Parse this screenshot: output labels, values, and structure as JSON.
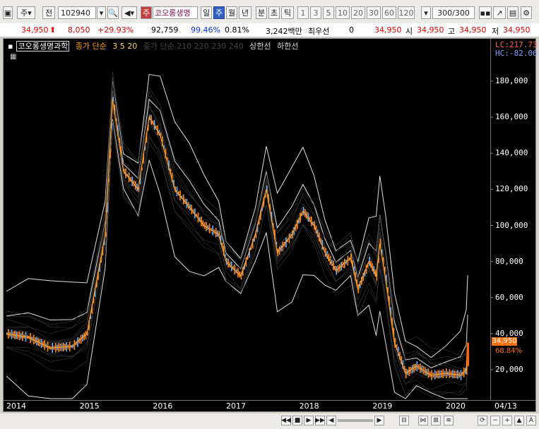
{
  "toolbar": {
    "market": "주",
    "market2": "전",
    "code": "102940",
    "name": "코오롱생명",
    "period_label": "주",
    "periods": [
      "일",
      "주",
      "월",
      "년",
      "분",
      "초",
      "틱"
    ],
    "intervals": [
      "1",
      "3",
      "5",
      "10",
      "20",
      "30",
      "60",
      "120"
    ],
    "count": "300/300"
  },
  "quote": {
    "price": "34,950",
    "change": "8,050",
    "change_pct": "+29.93%",
    "volume": "92,759",
    "vol_ratio": "99.46%",
    "turnover": "0.81%",
    "amount": "3,242백만",
    "pref_label": "최우선",
    "pref_val": "0",
    "last": "34,950",
    "open_label": "시",
    "open": "34,950",
    "high_label": "고",
    "high": "34,950",
    "low_label": "저",
    "low": "34,950"
  },
  "legend": {
    "name": "코오롱생명과학",
    "ma_label": "종가 단순",
    "ma_periods": "3  5  20",
    "ma2_label": "종가 단순 210 220 230 240",
    "upper": "상한선",
    "lower": "하한선"
  },
  "chart_data": {
    "type": "line",
    "y_ticks": [
      "180,000",
      "160,000",
      "140,000",
      "120,000",
      "100,000",
      "80,000",
      "60,000",
      "40,000",
      "20,000"
    ],
    "x_ticks": [
      "2014",
      "2015",
      "2016",
      "2017",
      "2018",
      "2019",
      "2020",
      "04/13"
    ],
    "lc": "LC:217.73",
    "hc": "HC:-82.06",
    "last_price": "34,950",
    "last_pct": "68.84%",
    "ylim": [
      0,
      200000
    ],
    "series": [
      {
        "values": [
          [
            2014.0,
            40000
          ],
          [
            2014.3,
            38000
          ],
          [
            2014.6,
            32000
          ],
          [
            2014.9,
            33000
          ],
          [
            2015.1,
            40000
          ],
          [
            2015.35,
            95000
          ],
          [
            2015.45,
            170000
          ],
          [
            2015.6,
            130000
          ],
          [
            2015.8,
            120000
          ],
          [
            2015.95,
            160000
          ],
          [
            2016.1,
            150000
          ],
          [
            2016.3,
            120000
          ],
          [
            2016.5,
            110000
          ],
          [
            2016.7,
            100000
          ],
          [
            2016.9,
            95000
          ],
          [
            2017.0,
            80000
          ],
          [
            2017.2,
            72000
          ],
          [
            2017.4,
            95000
          ],
          [
            2017.55,
            120000
          ],
          [
            2017.7,
            85000
          ],
          [
            2017.9,
            95000
          ],
          [
            2018.05,
            108000
          ],
          [
            2018.2,
            100000
          ],
          [
            2018.35,
            85000
          ],
          [
            2018.5,
            75000
          ],
          [
            2018.7,
            82000
          ],
          [
            2018.8,
            65000
          ],
          [
            2018.95,
            80000
          ],
          [
            2019.05,
            72000
          ],
          [
            2019.1,
            90000
          ],
          [
            2019.18,
            70000
          ],
          [
            2019.3,
            35000
          ],
          [
            2019.45,
            18000
          ],
          [
            2019.6,
            22000
          ],
          [
            2019.8,
            17000
          ],
          [
            2020.0,
            18000
          ],
          [
            2020.2,
            17000
          ],
          [
            2020.28,
            20000
          ],
          [
            2020.3,
            34950
          ]
        ]
      }
    ]
  }
}
